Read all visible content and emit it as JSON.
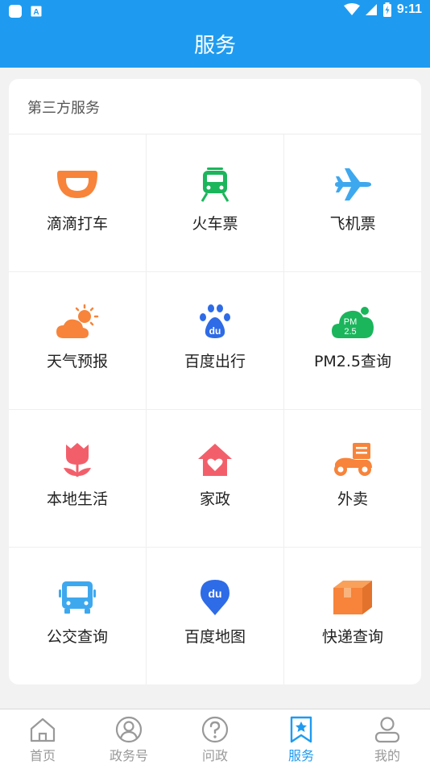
{
  "status_bar": {
    "time": "9:11",
    "notification_glyph": "A"
  },
  "header": {
    "title": "服务"
  },
  "section": {
    "title": "第三方服务",
    "items": [
      {
        "label": "滴滴打车",
        "icon": "didi-icon",
        "color": "#f7843a"
      },
      {
        "label": "火车票",
        "icon": "train-icon",
        "color": "#1bb55c"
      },
      {
        "label": "飞机票",
        "icon": "airplane-icon",
        "color": "#3ea8ef"
      },
      {
        "label": "天气预报",
        "icon": "weather-icon",
        "color": "#f7843a"
      },
      {
        "label": "百度出行",
        "icon": "baidu-paw-icon",
        "color": "#2e6be6"
      },
      {
        "label": "PM2.5查询",
        "icon": "pm25-cloud-icon",
        "color": "#1bb55c",
        "icon_text_top": "PM",
        "icon_text_bottom": "2.5"
      },
      {
        "label": "本地生活",
        "icon": "tulip-icon",
        "color": "#f25f6b"
      },
      {
        "label": "家政",
        "icon": "house-heart-icon",
        "color": "#f25f6b"
      },
      {
        "label": "外卖",
        "icon": "delivery-scooter-icon",
        "color": "#f7843a"
      },
      {
        "label": "公交查询",
        "icon": "bus-icon",
        "color": "#3ea8ef"
      },
      {
        "label": "百度地图",
        "icon": "baidu-map-pin-icon",
        "color": "#2e6be6",
        "icon_text": "du"
      },
      {
        "label": "快递查询",
        "icon": "package-box-icon",
        "color": "#f7843a"
      }
    ]
  },
  "tabs": [
    {
      "label": "首页",
      "icon": "home-icon",
      "active": false
    },
    {
      "label": "政务号",
      "icon": "account-circle-icon",
      "active": false
    },
    {
      "label": "问政",
      "icon": "question-icon",
      "active": false
    },
    {
      "label": "服务",
      "icon": "bookmark-star-icon",
      "active": true
    },
    {
      "label": "我的",
      "icon": "user-icon",
      "active": false
    }
  ],
  "colors": {
    "primary": "#1e9bf0",
    "inactive_tab": "#999999"
  }
}
